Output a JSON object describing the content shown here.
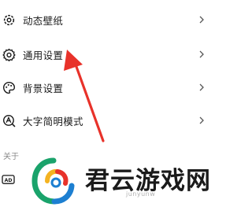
{
  "settings": {
    "items": [
      {
        "label": "动态壁纸",
        "icon": "sparkle-gear-icon"
      },
      {
        "label": "通用设置",
        "icon": "gear-icon"
      },
      {
        "label": "背景设置",
        "icon": "palette-icon"
      },
      {
        "label": "大字简明模式",
        "icon": "font-search-icon"
      }
    ],
    "section_about": "关于",
    "about_item_icon_text": "AD"
  },
  "annotation": {
    "arrow_color": "#e8322a"
  },
  "watermark": {
    "title": "君云游戏网",
    "subtitle": "junyunw",
    "logo_colors": [
      "#1aa36b",
      "#1d7fd1",
      "#f4b321",
      "#e8322a"
    ]
  }
}
